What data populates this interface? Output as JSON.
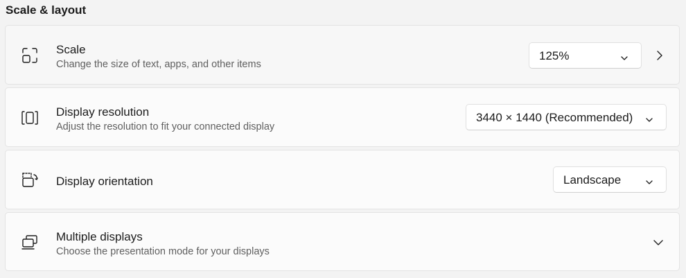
{
  "section": {
    "title": "Scale & layout"
  },
  "scale": {
    "title": "Scale",
    "subtitle": "Change the size of text, apps, and other items",
    "value": "125%",
    "icon": "scale-icon"
  },
  "resolution": {
    "title": "Display resolution",
    "subtitle": "Adjust the resolution to fit your connected display",
    "value": "3440 × 1440 (Recommended)",
    "icon": "resolution-icon"
  },
  "orientation": {
    "title": "Display orientation",
    "value": "Landscape",
    "icon": "orientation-icon"
  },
  "multiple": {
    "title": "Multiple displays",
    "subtitle": "Choose the presentation mode for your displays",
    "icon": "multiple-displays-icon"
  },
  "colors": {
    "background": "#f3f3f3",
    "card": "#fbfbfb",
    "text": "#1b1b1b",
    "subtext": "#5f5f5f"
  }
}
